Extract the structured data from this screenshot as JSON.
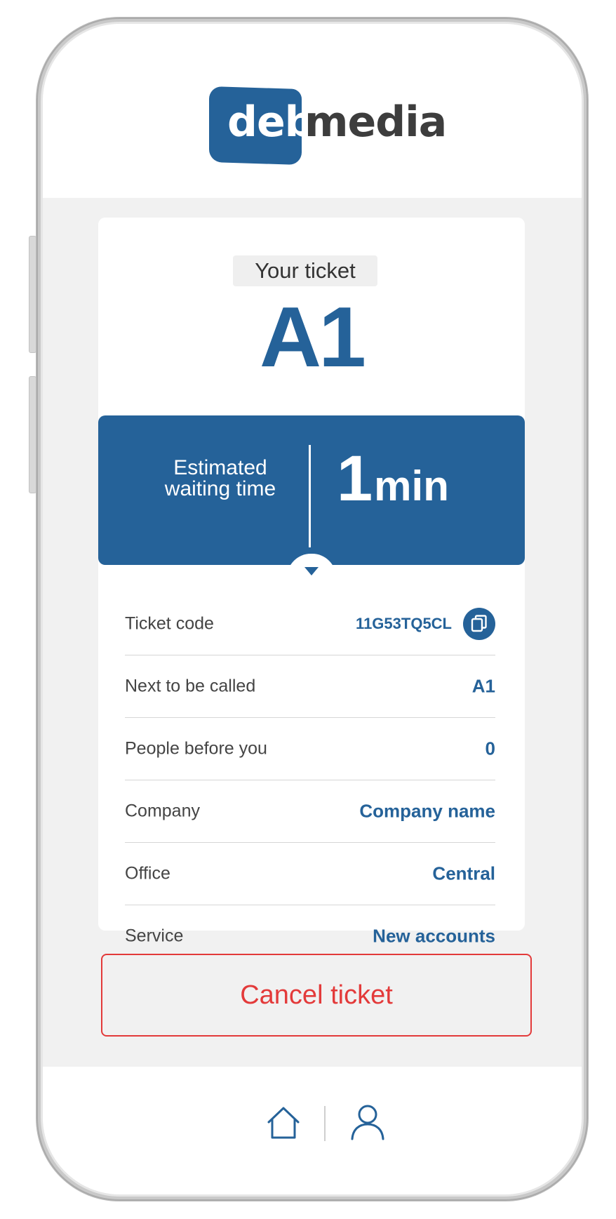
{
  "brand": {
    "logo_part1": "deb",
    "logo_part2": "media",
    "primary_color": "#256299",
    "danger_color": "#e33a3a"
  },
  "ticket": {
    "label": "Your ticket",
    "number": "A1"
  },
  "wait": {
    "label_line1": "Estimated",
    "label_line2": "waiting time",
    "value": "1",
    "unit": "min"
  },
  "details": {
    "ticket_code": {
      "label": "Ticket code",
      "value": "11G53TQ5CL",
      "action_icon": "copy-icon"
    },
    "next_called": {
      "label": "Next to be called",
      "value": "A1"
    },
    "people_before": {
      "label": "People before you",
      "value": "0"
    },
    "company": {
      "label": "Company",
      "value": "Company name"
    },
    "office": {
      "label": "Office",
      "value": "Central"
    },
    "service": {
      "label": "Service",
      "value": "New accounts"
    }
  },
  "actions": {
    "cancel_label": "Cancel ticket"
  },
  "nav": {
    "items": [
      {
        "icon": "home-icon"
      },
      {
        "icon": "user-icon"
      }
    ]
  }
}
